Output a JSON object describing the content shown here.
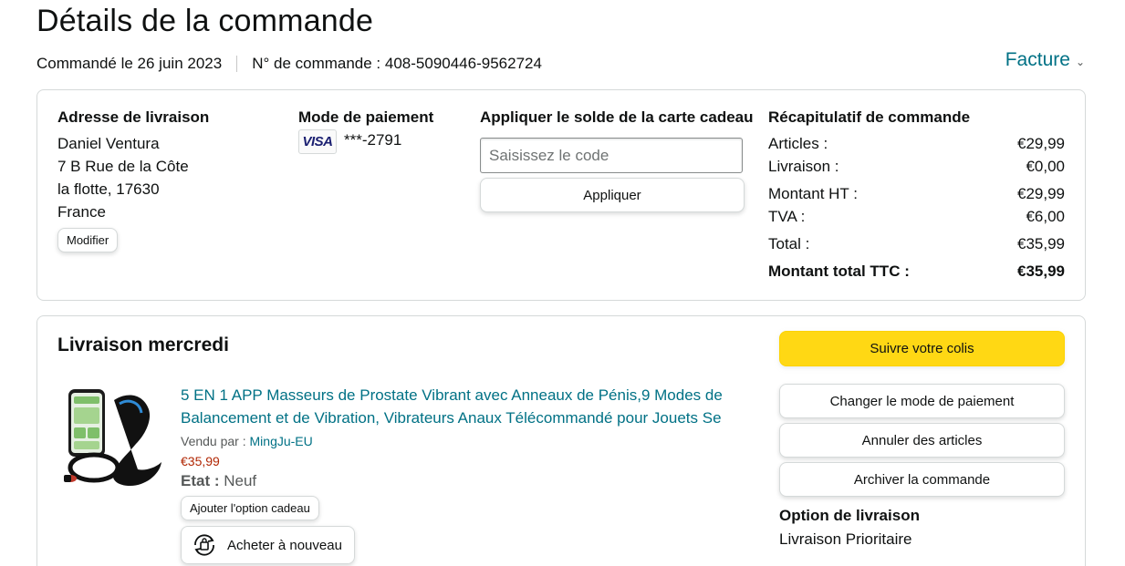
{
  "header": {
    "title": "Détails de la commande",
    "ordered_date": "Commandé le 26 juin 2023",
    "order_number": "N° de commande : 408-5090446-9562724",
    "invoice_label": "Facture"
  },
  "shipping_address": {
    "heading": "Adresse de livraison",
    "lines": [
      "Daniel Ventura",
      "7 B Rue de la Côte",
      "la flotte, 17630",
      "France"
    ],
    "edit_label": "Modifier"
  },
  "payment": {
    "heading": "Mode de paiement",
    "card_brand": "VISA",
    "card_number": "***-2791"
  },
  "gift_card": {
    "heading": "Appliquer le solde de la carte cadeau",
    "placeholder": "Saisissez le code",
    "apply_label": "Appliquer"
  },
  "summary": {
    "heading": "Récapitulatif de commande",
    "rows": [
      {
        "label": "Articles :",
        "value": "€29,99"
      },
      {
        "label": "Livraison :",
        "value": "€0,00"
      },
      {
        "label": "Montant HT :",
        "value": "€29,99"
      },
      {
        "label": "TVA :",
        "value": "€6,00"
      },
      {
        "label": "Total :",
        "value": "€35,99"
      },
      {
        "label": "Montant total TTC :",
        "value": "€35,99"
      }
    ]
  },
  "delivery": {
    "title": "Livraison mercredi",
    "product": {
      "title": "5 EN 1 APP Masseurs de Prostate Vibrant avec Anneaux de Pénis,9 Modes de Balancement et de Vibration, Vibrateurs Anaux Télécommandé pour Jouets Se",
      "sold_by_label": "Vendu par :",
      "seller": "MingJu-EU",
      "price": "€35,99",
      "condition_label": "Etat :",
      "condition_value": "Neuf",
      "gift_option_label": "Ajouter l'option cadeau",
      "rebuy_label": "Acheter à nouveau"
    },
    "actions": {
      "track": "Suivre votre colis",
      "change_payment": "Changer le mode de paiement",
      "cancel_items": "Annuler des articles",
      "archive_order": "Archiver la commande"
    },
    "shipping_option_label": "Option de livraison",
    "shipping_option_value": "Livraison Prioritaire"
  },
  "colors": {
    "link": "#007185",
    "price": "#b12704",
    "primary_button": "#ffd814",
    "border": "#d5d9d9"
  }
}
